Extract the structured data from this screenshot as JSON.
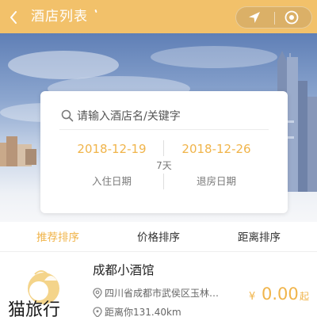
{
  "header": {
    "title": "酒店列表",
    "bar_color": "#f2c16a",
    "back_icon": "chevron-left-icon",
    "menu_icons": [
      "location-arrow-icon",
      "target-circle-icon"
    ]
  },
  "banner": {
    "subject": "city skyline"
  },
  "search": {
    "placeholder": "请输入酒店名/关键字",
    "icon": "search-icon",
    "checkin_date": "2018-12-19",
    "checkout_date": "2018-12-26",
    "nights": "7天",
    "checkin_label": "入住日期",
    "checkout_label": "退房日期"
  },
  "sort": {
    "tabs": [
      {
        "label": "推荐排序",
        "active": true
      },
      {
        "label": "价格排序",
        "active": false
      },
      {
        "label": "距离排序",
        "active": false
      }
    ],
    "accent_color": "#f0b44a"
  },
  "hotels": [
    {
      "name": "成都小酒馆",
      "logo_text": "猫旅行",
      "address": "四川省成都市武侯区玉林…",
      "distance": "距离你131.40km",
      "currency": "¥",
      "price": "0.00",
      "price_suffix": "起"
    }
  ]
}
